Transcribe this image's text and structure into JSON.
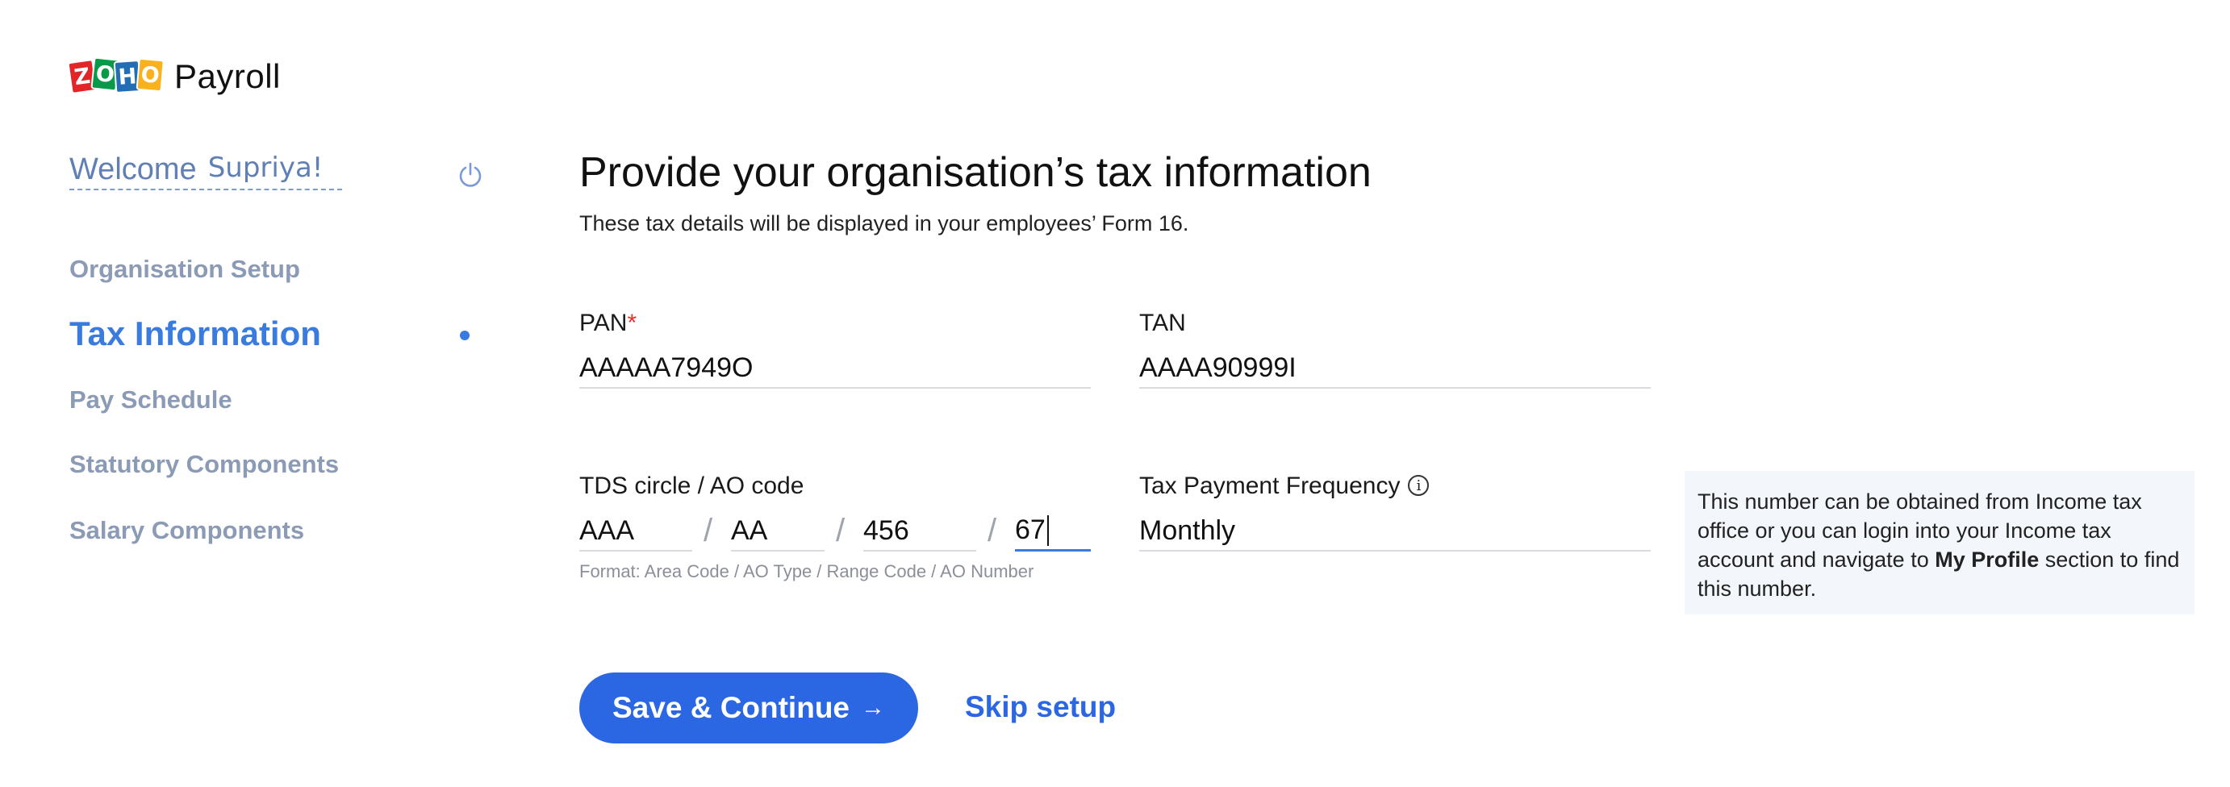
{
  "app": {
    "logo_letters": [
      "Z",
      "O",
      "H",
      "O"
    ],
    "product": "Payroll"
  },
  "sidebar": {
    "welcome": "Welcome",
    "user_name": "Supriya!",
    "items": [
      {
        "label": "Organisation Setup",
        "active": false
      },
      {
        "label": "Tax Information",
        "active": true
      },
      {
        "label": "Pay Schedule",
        "active": false
      },
      {
        "label": "Statutory Components",
        "active": false
      },
      {
        "label": "Salary Components",
        "active": false
      }
    ]
  },
  "main": {
    "title": "Provide your organisation’s tax information",
    "subtitle": "These tax details will be displayed in your employees’ Form 16.",
    "pan": {
      "label": "PAN",
      "required_mark": "*",
      "value": "AAAAA7949O"
    },
    "tan": {
      "label": "TAN",
      "value": "AAAA90999I"
    },
    "tds": {
      "label": "TDS circle / AO code",
      "area_code": "AAA",
      "ao_type": "AA",
      "range_code": "456",
      "ao_number": "67",
      "separator": "/",
      "format_hint": "Format: Area Code / AO Type / Range Code / AO Number"
    },
    "tax_frequency": {
      "label": "Tax Payment Frequency",
      "value": "Monthly",
      "info_glyph": "i"
    },
    "tip": {
      "text_before": "This number can be obtained from Income tax office or you can login into your Income tax account and navigate to ",
      "bold": "My Profile",
      "text_after": " section to find this number."
    },
    "actions": {
      "save_label": "Save & Continue",
      "save_arrow": "→",
      "skip_label": "Skip setup"
    }
  },
  "colors": {
    "accent": "#2b66e3",
    "active_nav": "#3a7be0",
    "muted_nav": "#8c9bb5",
    "required": "#e4322b",
    "tip_bg": "#f3f7fc"
  }
}
